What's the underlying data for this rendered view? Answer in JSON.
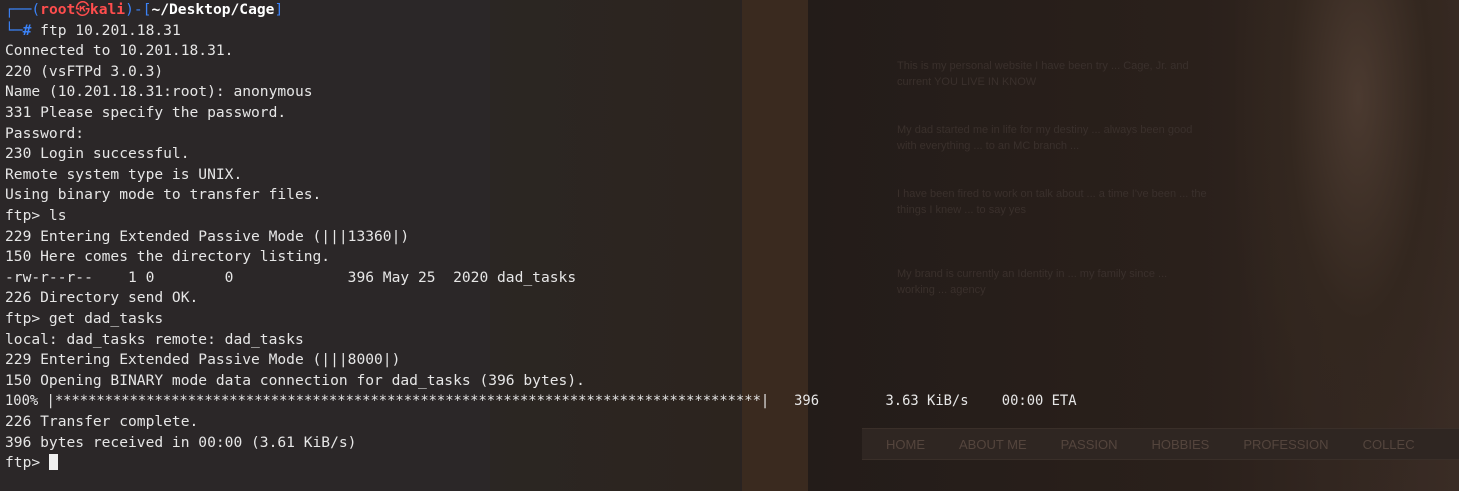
{
  "background_page": {
    "paragraphs": [
      "This is my personal website I have been try ... Cage, Jr. and current YOU LIVE IN KNOW",
      "My dad started me in life for my destiny ... always been good with everything ... to an MC branch ...",
      "I have been fired to work on talk about ... a time I've been ... the things I knew ... to say yes",
      "My brand is currently an Identity in ... my family since ... working ... agency"
    ],
    "nav_items": [
      "HOME",
      "ABOUT ME",
      "PASSION",
      "HOBBIES",
      "PROFESSION",
      "COLLEC"
    ]
  },
  "terminal": {
    "prompt": {
      "frame_top": "┌──(",
      "user": "root",
      "at": "㉿",
      "host": "kali",
      "frame_mid": ")-[",
      "path": "~/Desktop/Cage",
      "frame_end": "]",
      "frame_bottom": "└─",
      "hash": "# ",
      "command": "ftp 10.201.18.31"
    },
    "lines": [
      "Connected to 10.201.18.31.",
      "220 (vsFTPd 3.0.3)",
      "Name (10.201.18.31:root): anonymous",
      "331 Please specify the password.",
      "Password:",
      "230 Login successful.",
      "Remote system type is UNIX.",
      "Using binary mode to transfer files.",
      "ftp> ls",
      "229 Entering Extended Passive Mode (|||13360|)",
      "150 Here comes the directory listing.",
      "-rw-r--r--    1 0        0             396 May 25  2020 dad_tasks",
      "226 Directory send OK.",
      "ftp> get dad_tasks",
      "local: dad_tasks remote: dad_tasks",
      "229 Entering Extended Passive Mode (|||8000|)",
      "150 Opening BINARY mode data connection for dad_tasks (396 bytes).",
      "100% |*************************************************************************************|   396        3.63 KiB/s    00:00 ETA",
      "226 Transfer complete.",
      "396 bytes received in 00:00 (3.61 KiB/s)"
    ],
    "final_prompt": "ftp> "
  }
}
